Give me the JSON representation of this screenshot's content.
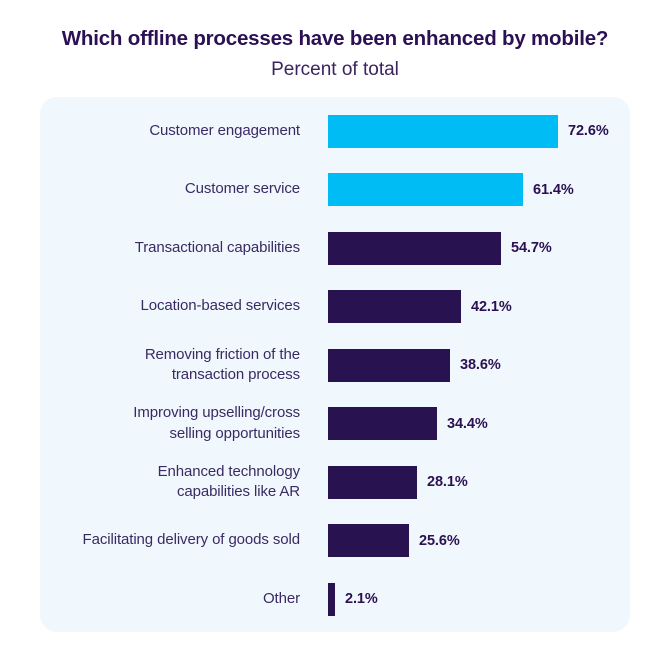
{
  "header": {
    "title": "Which offline processes have been enhanced by mobile?",
    "subtitle": "Percent of total"
  },
  "colors": {
    "page_background": "#ffffff",
    "card_background": "#f0f8fd",
    "bar_highlight": "#00bcf5",
    "bar_default": "#28124f",
    "title_text": "#2b1053",
    "label_text": "#3a2a63",
    "value_text": "#2b1053"
  },
  "chart_data": {
    "type": "bar",
    "orientation": "horizontal",
    "title": "Which offline processes have been enhanced by mobile?",
    "subtitle": "Percent of total",
    "xlabel": "",
    "ylabel": "",
    "xlim": [
      0,
      80
    ],
    "grid": false,
    "legend": "none",
    "value_suffix": "%",
    "categories": [
      "Customer engagement",
      "Customer service",
      "Transactional capabilities",
      "Location-based services",
      "Removing friction of the transaction process",
      "Improving upselling/cross selling opportunities",
      "Enhanced technology capabilities like AR",
      "Facilitating delivery of goods sold",
      "Other"
    ],
    "values": [
      72.6,
      61.4,
      54.7,
      42.1,
      38.6,
      34.4,
      28.1,
      25.6,
      2.1
    ],
    "bars": [
      {
        "label": "Customer engagement",
        "label_lines": "Customer engagement",
        "value": 72.6,
        "value_label": "72.6%",
        "color": "#00bcf5"
      },
      {
        "label": "Customer service",
        "label_lines": "Customer service",
        "value": 61.4,
        "value_label": "61.4%",
        "color": "#00bcf5"
      },
      {
        "label": "Transactional capabilities",
        "label_lines": "Transactional capabilities",
        "value": 54.7,
        "value_label": "54.7%",
        "color": "#28124f"
      },
      {
        "label": "Location-based services",
        "label_lines": "Location-based services",
        "value": 42.1,
        "value_label": "42.1%",
        "color": "#28124f"
      },
      {
        "label": "Removing friction of the transaction process",
        "label_lines": "Removing friction of the\ntransaction process",
        "value": 38.6,
        "value_label": "38.6%",
        "color": "#28124f"
      },
      {
        "label": "Improving upselling/cross selling opportunities",
        "label_lines": "Improving upselling/cross\nselling opportunities",
        "value": 34.4,
        "value_label": "34.4%",
        "color": "#28124f"
      },
      {
        "label": "Enhanced technology capabilities like AR",
        "label_lines": "Enhanced technology\ncapabilities like AR",
        "value": 28.1,
        "value_label": "28.1%",
        "color": "#28124f"
      },
      {
        "label": "Facilitating delivery of goods sold",
        "label_lines": "Facilitating delivery of goods sold",
        "value": 25.6,
        "value_label": "25.6%",
        "color": "#28124f"
      },
      {
        "label": "Other",
        "label_lines": "Other",
        "value": 2.1,
        "value_label": "2.1%",
        "color": "#28124f"
      }
    ]
  }
}
